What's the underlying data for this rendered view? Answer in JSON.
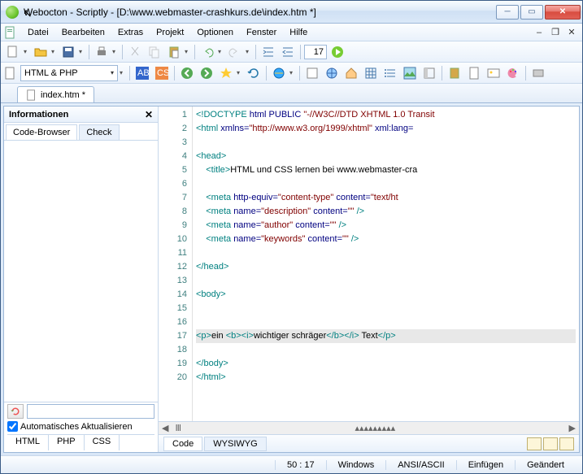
{
  "window": {
    "title": "Webocton - Scriptly - [D:\\www.webmaster-crashkurs.de\\index.htm *]"
  },
  "menu": {
    "items": [
      "Datei",
      "Bearbeiten",
      "Extras",
      "Projekt",
      "Optionen",
      "Fenster",
      "Hilfe"
    ]
  },
  "toolbar1": {
    "line_input": "17"
  },
  "lang_selector": {
    "value": "HTML & PHP"
  },
  "file_tab": {
    "label": "index.htm *"
  },
  "info_panel": {
    "title": "Informationen",
    "tabs": {
      "active": "Code-Browser",
      "inactive": "Check"
    },
    "auto_update": "Automatisches Aktualisieren",
    "lang_tabs": [
      "HTML",
      "PHP",
      "CSS"
    ]
  },
  "editor": {
    "view_tabs": {
      "code": "Code",
      "wysiwyg": "WYSIWYG"
    },
    "lines": [
      {
        "n": 1,
        "html": "<span class='c-t'>&lt;!DOCTYPE</span> <span class='c-a'>html PUBLIC</span> <span class='c-s'>\"-//W3C//DTD XHTML 1.0 Transit</span>"
      },
      {
        "n": 2,
        "html": "<span class='c-t'>&lt;html</span> <span class='c-a'>xmlns=</span><span class='c-s'>\"http://www.w3.org/1999/xhtml\"</span> <span class='c-a'>xml:lang=</span>"
      },
      {
        "n": 3,
        "html": ""
      },
      {
        "n": 4,
        "html": "<span class='c-t'>&lt;head&gt;</span>"
      },
      {
        "n": 5,
        "html": "    <span class='c-t'>&lt;title&gt;</span>HTML und CSS lernen bei www.webmaster-cra"
      },
      {
        "n": 6,
        "html": ""
      },
      {
        "n": 7,
        "html": "    <span class='c-t'>&lt;meta</span> <span class='c-a'>http-equiv=</span><span class='c-s'>\"content-type\"</span> <span class='c-a'>content=</span><span class='c-s'>\"text/ht</span>"
      },
      {
        "n": 8,
        "html": "    <span class='c-t'>&lt;meta</span> <span class='c-a'>name=</span><span class='c-s'>\"description\"</span> <span class='c-a'>content=</span><span class='c-s'>\"\"</span> <span class='c-t'>/&gt;</span>"
      },
      {
        "n": 9,
        "html": "    <span class='c-t'>&lt;meta</span> <span class='c-a'>name=</span><span class='c-s'>\"author\"</span> <span class='c-a'>content=</span><span class='c-s'>\"\"</span> <span class='c-t'>/&gt;</span>"
      },
      {
        "n": 10,
        "html": "    <span class='c-t'>&lt;meta</span> <span class='c-a'>name=</span><span class='c-s'>\"keywords\"</span> <span class='c-a'>content=</span><span class='c-s'>\"\"</span> <span class='c-t'>/&gt;</span>"
      },
      {
        "n": 11,
        "html": ""
      },
      {
        "n": 12,
        "html": "<span class='c-t'>&lt;/head&gt;</span>"
      },
      {
        "n": 13,
        "html": ""
      },
      {
        "n": 14,
        "html": "<span class='c-t'>&lt;body&gt;</span>"
      },
      {
        "n": 15,
        "html": ""
      },
      {
        "n": 16,
        "html": ""
      },
      {
        "n": 17,
        "html": "<span class='c-t'>&lt;p&gt;</span>ein <span class='c-t'>&lt;b&gt;&lt;i&gt;</span>wichtiger schräger<span class='c-t'>&lt;/b&gt;&lt;/i&gt;</span> Text<span class='c-t'>&lt;/p&gt;</span>",
        "hl": true
      },
      {
        "n": 18,
        "html": ""
      },
      {
        "n": 19,
        "html": "<span class='c-t'>&lt;/body&gt;</span>"
      },
      {
        "n": 20,
        "html": "<span class='c-t'>&lt;/html&gt;</span>"
      }
    ]
  },
  "status": {
    "pos": "50 : 17",
    "os": "Windows",
    "encoding": "ANSI/ASCII",
    "mode": "Einfügen",
    "state": "Geändert"
  }
}
